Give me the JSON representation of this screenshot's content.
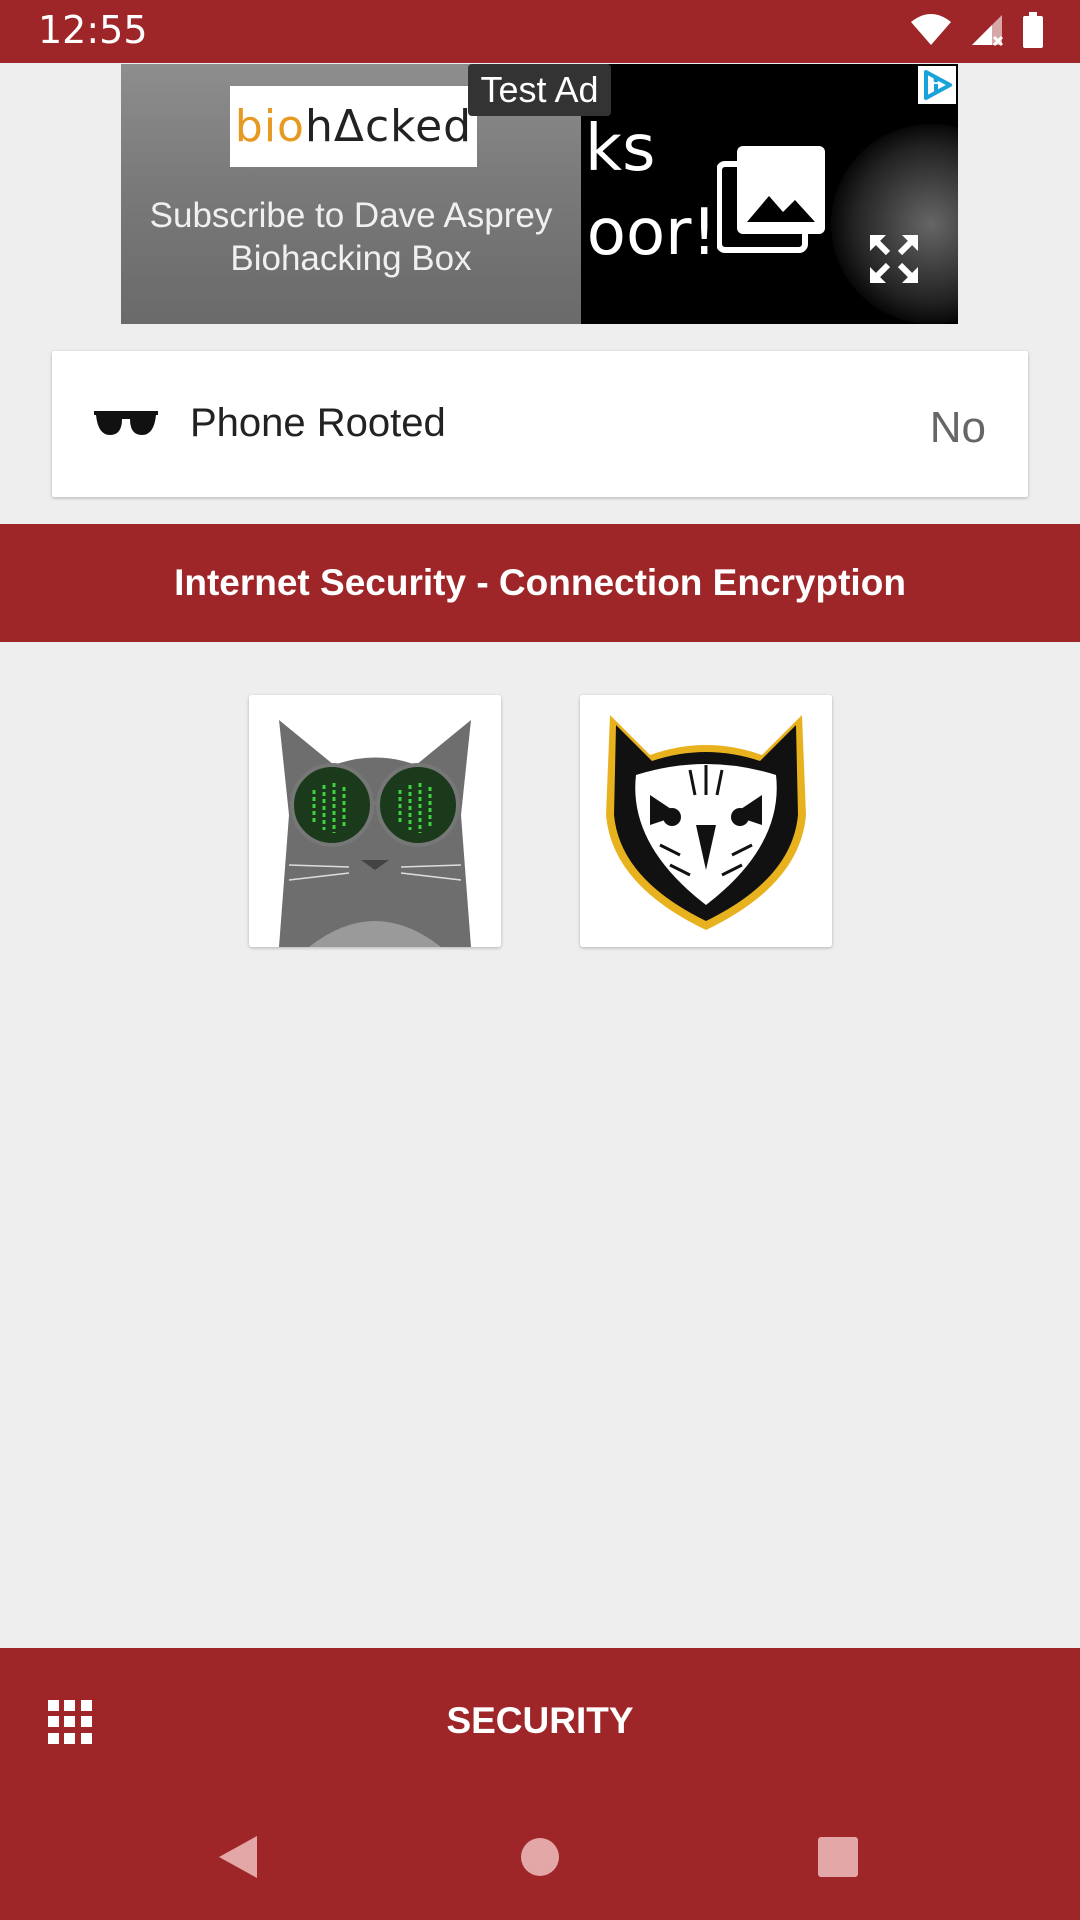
{
  "status_bar": {
    "time": "12:55",
    "icons": [
      "wifi-icon",
      "signal-icon",
      "battery-icon"
    ]
  },
  "ad": {
    "test_label": "Test Ad",
    "logo_prefix": "bio",
    "logo_text": "hΔcked",
    "subtitle": "Subscribe to Dave Asprey Biohacking Box",
    "image_text_1": "ks",
    "image_text_2": "loor!",
    "icons": [
      "ad-choices-icon",
      "image-icon",
      "expand-icon"
    ]
  },
  "security_card": {
    "label": "Phone Rooted",
    "value": "No",
    "icon": "sunglasses-icon"
  },
  "section": {
    "title": "Internet Security - Connection Encryption"
  },
  "tiles": [
    {
      "name": "cat-with-glasses-image"
    },
    {
      "name": "owl-image"
    }
  ],
  "bottom_bar": {
    "title": "SECURITY",
    "menu_icon": "grid-menu-icon"
  },
  "colors": {
    "primary": "#9e2629",
    "background": "#eeeeee",
    "card": "#ffffff"
  }
}
